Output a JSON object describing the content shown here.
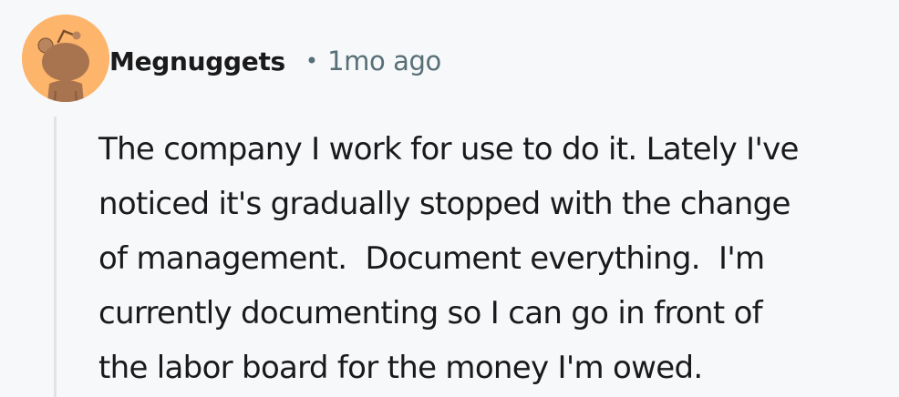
{
  "comment": {
    "username": "Megnuggets",
    "separator": "•",
    "timestamp": "1mo ago",
    "avatar_icon": "reddit-snoo-avatar-icon",
    "avatar_color": "#fdb46b",
    "body_lines": [
      "The company I work for use to do it. Lately I've",
      "noticed it's gradually stopped with the change",
      "of management.  Document everything.  I'm",
      "currently documenting so I can go in front of",
      "the labor board for the money I'm owed."
    ]
  }
}
